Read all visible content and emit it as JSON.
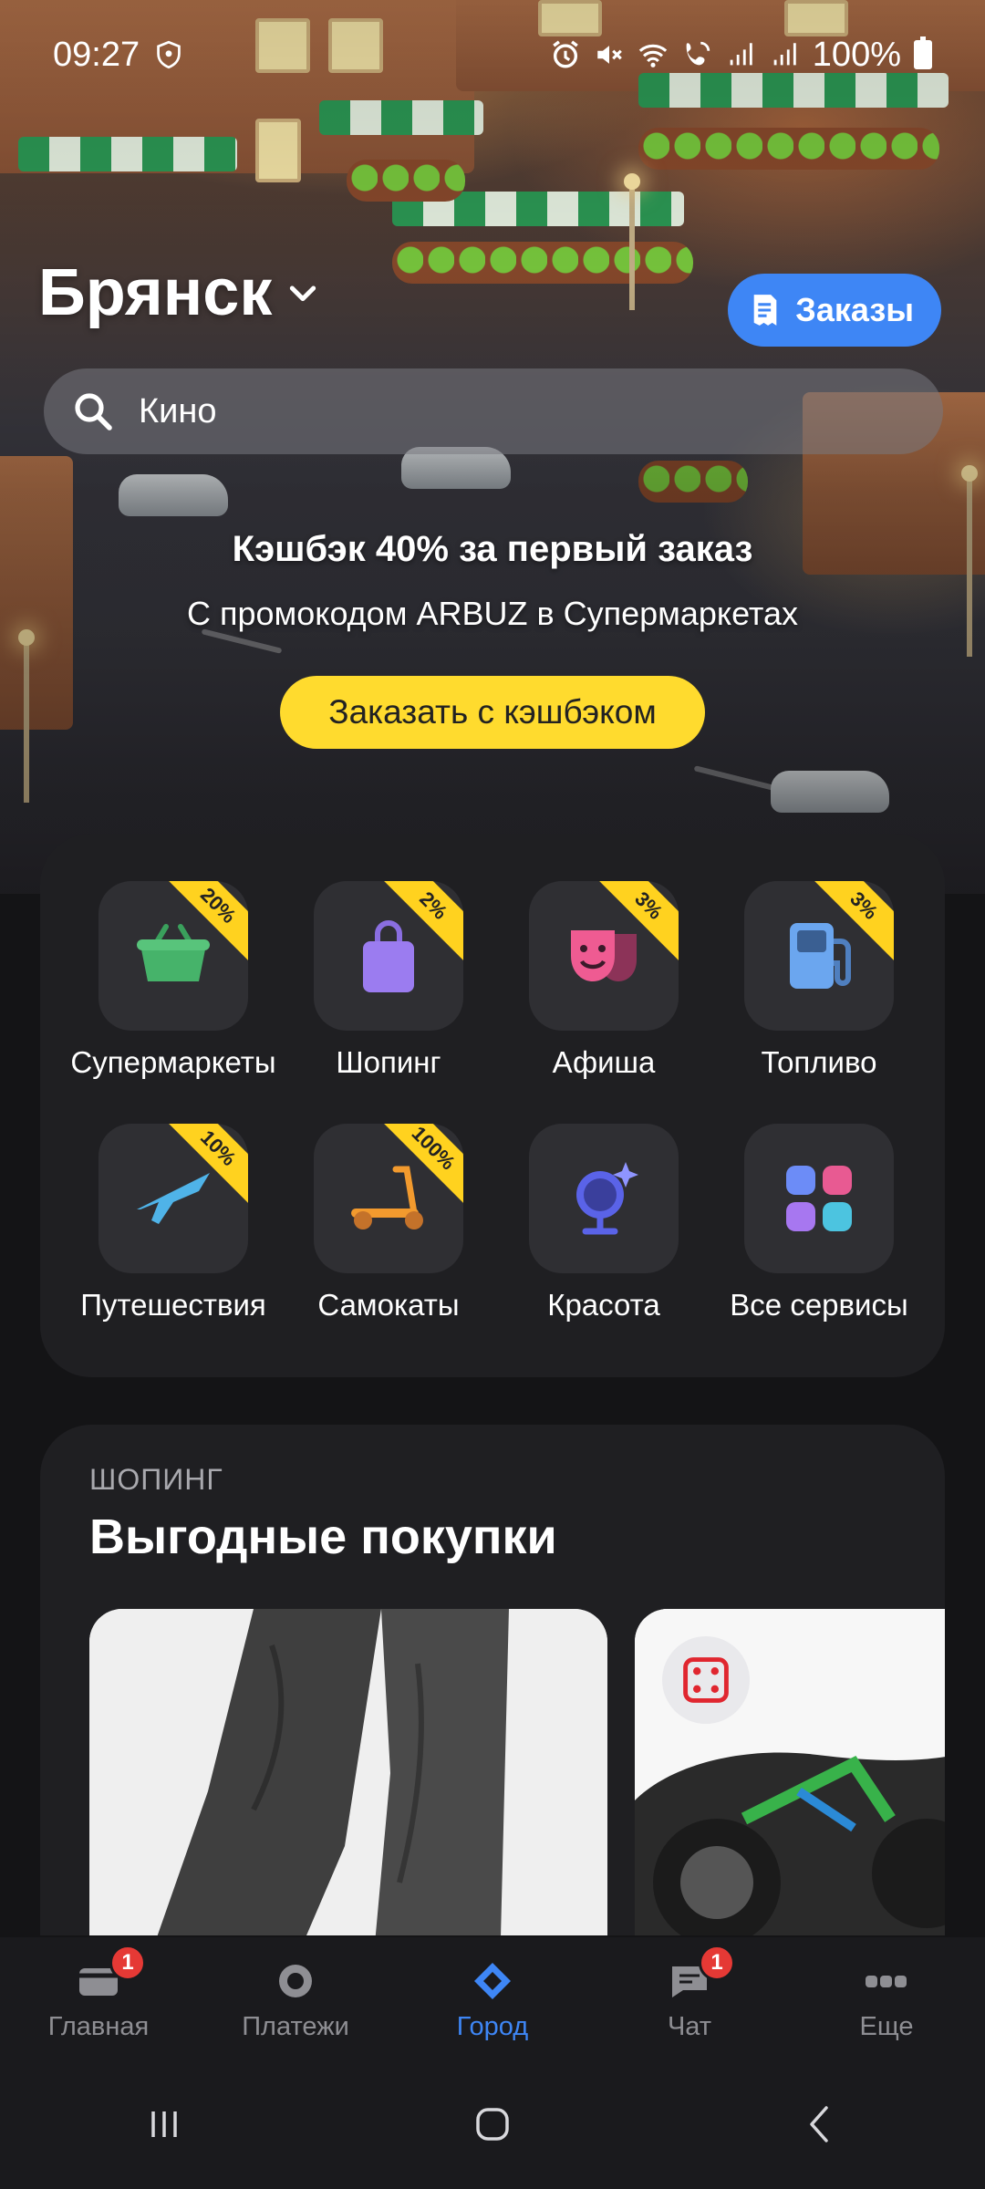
{
  "status_bar": {
    "time": "09:27",
    "battery": "100%"
  },
  "header": {
    "city": "Брянск",
    "orders_label": "Заказы"
  },
  "search": {
    "text": "Кино"
  },
  "promo": {
    "title": "Кэшбэк 40% за первый заказ",
    "subtitle": "С промокодом ARBUZ в Супермаркетах",
    "button": "Заказать с кэшбэком"
  },
  "services": [
    {
      "label": "Супермаркеты",
      "badge": "20%",
      "icon": "basket-icon"
    },
    {
      "label": "Шопинг",
      "badge": "2%",
      "icon": "shopping-bag-icon"
    },
    {
      "label": "Афиша",
      "badge": "3%",
      "icon": "theater-masks-icon"
    },
    {
      "label": "Топливо",
      "badge": "3%",
      "icon": "fuel-pump-icon"
    },
    {
      "label": "Путешествия",
      "badge": "10%",
      "icon": "airplane-icon"
    },
    {
      "label": "Самокаты",
      "badge": "100%",
      "icon": "scooter-icon"
    },
    {
      "label": "Красота",
      "badge": "",
      "icon": "mirror-sparkle-icon"
    },
    {
      "label": "Все сервисы",
      "badge": "",
      "icon": "grid-apps-icon"
    }
  ],
  "deals": {
    "kicker": "ШОПИНГ",
    "title": "Выгодные покупки"
  },
  "bottom_nav": [
    {
      "label": "Главная",
      "badge": "1",
      "icon": "home-card-icon"
    },
    {
      "label": "Платежи",
      "badge": "",
      "icon": "payments-icon"
    },
    {
      "label": "Город",
      "badge": "",
      "icon": "city-icon",
      "active": true
    },
    {
      "label": "Чат",
      "badge": "1",
      "icon": "chat-icon"
    },
    {
      "label": "Еще",
      "badge": "",
      "icon": "more-icon"
    }
  ],
  "colors": {
    "accent": "#3e86f5",
    "promo_button": "#ffdb2e",
    "badge": "#ffd21f",
    "card_bg": "#1f1f22"
  }
}
